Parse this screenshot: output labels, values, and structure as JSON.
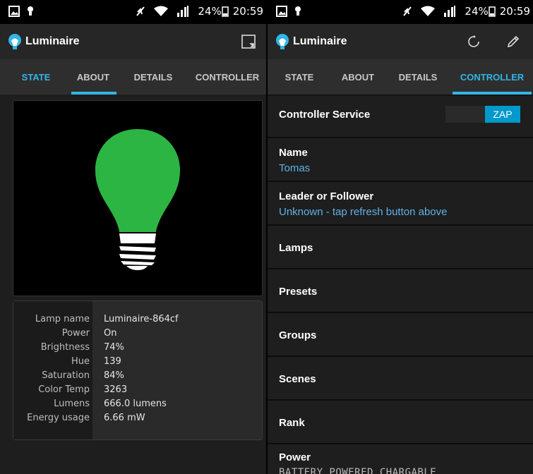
{
  "status_left": {
    "battery": "24%",
    "time": "20:59"
  },
  "status_right": {
    "battery": "24%",
    "time": "20:59"
  },
  "app": {
    "title": "Luminaire"
  },
  "colors": {
    "accent": "#33b5e5",
    "bulb": "#2db543",
    "link": "#5eb2e8",
    "zap": "#0099cc"
  },
  "tabs": [
    "STATE",
    "ABOUT",
    "DETAILS",
    "CONTROLLER"
  ],
  "left": {
    "active_tab": "STATE",
    "action_icon": "expand-icon"
  },
  "right": {
    "active_tab": "CONTROLLER",
    "action_icons": [
      "refresh-icon",
      "pencil-icon"
    ]
  },
  "lamp_info": [
    {
      "label": "Lamp name",
      "value": "Luminaire-864cf"
    },
    {
      "label": "Power",
      "value": "On"
    },
    {
      "label": "Brightness",
      "value": "74%"
    },
    {
      "label": "Hue",
      "value": "139"
    },
    {
      "label": "Saturation",
      "value": "84%"
    },
    {
      "label": "Color Temp",
      "value": "3263"
    },
    {
      "label": "Lumens",
      "value": "666.0 lumens"
    },
    {
      "label": "Energy usage",
      "value": "6.66 mW"
    }
  ],
  "controller": {
    "service_label": "Controller Service",
    "zap_label": "ZAP",
    "name_label": "Name",
    "name_value": "Tomas",
    "leader_label": "Leader or Follower",
    "leader_value": "Unknown - tap refresh button above",
    "sections": [
      "Lamps",
      "Presets",
      "Groups",
      "Scenes",
      "Rank"
    ],
    "power_label": "Power",
    "power_value": "BATTERY_POWERED_CHARGABLE"
  }
}
